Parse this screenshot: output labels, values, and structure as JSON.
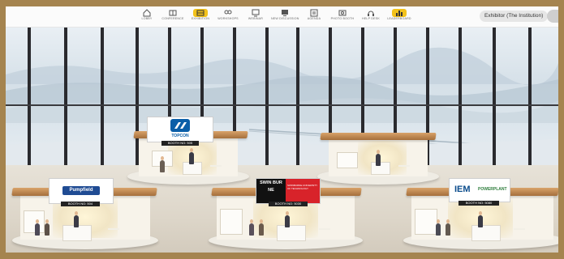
{
  "nav": {
    "items": [
      {
        "label": "LOBBY",
        "icon": "lobby-icon",
        "active": false
      },
      {
        "label": "CONFERENCE",
        "icon": "conference-icon",
        "active": false
      },
      {
        "label": "EXHIBITION",
        "icon": "exhibition-icon",
        "active": true
      },
      {
        "label": "WORKSHOPS",
        "icon": "workshops-icon",
        "active": false
      },
      {
        "label": "WEBINAR",
        "icon": "webinar-icon",
        "active": false
      },
      {
        "label": "NEW DISCUSSION",
        "icon": "discussion-icon",
        "active": false
      },
      {
        "label": "AGENDA",
        "icon": "agenda-icon",
        "active": false
      },
      {
        "label": "PHOTO BOOTH",
        "icon": "photo-booth-icon",
        "active": false
      },
      {
        "label": "HELP DESK",
        "icon": "help-desk-icon",
        "active": false
      },
      {
        "label": "LEADERBOARD",
        "icon": "leaderboard-icon",
        "active": true
      }
    ],
    "exhibitor_label": "Exhibitor (The Institution)"
  },
  "booths": [
    {
      "name": "TOPCON",
      "number": "BOOTH NO: 505",
      "brand_color": "#0a5ea8"
    },
    {
      "name": "Pumpfield",
      "number": "BOOTH NO: 504",
      "brand_color": "#1f4b93"
    },
    {
      "name": "SWIN BUR NE",
      "subtitle": "SWINBURNE UNIVERSITY OF TECHNOLOGY",
      "number": "BOOTH NO: 5030",
      "brand_color": "#d8232a"
    },
    {
      "name": "IEM",
      "subtitle": "POWERPLANT",
      "number": "BOOTH NO: 5080",
      "brand_color": "#0b4c8c"
    },
    {
      "name": "",
      "number": "",
      "brand_color": "#a56f3c"
    }
  ],
  "colors": {
    "frame": "#a5844f",
    "nav_active": "#f2c21b",
    "wood": "#c68a52"
  }
}
